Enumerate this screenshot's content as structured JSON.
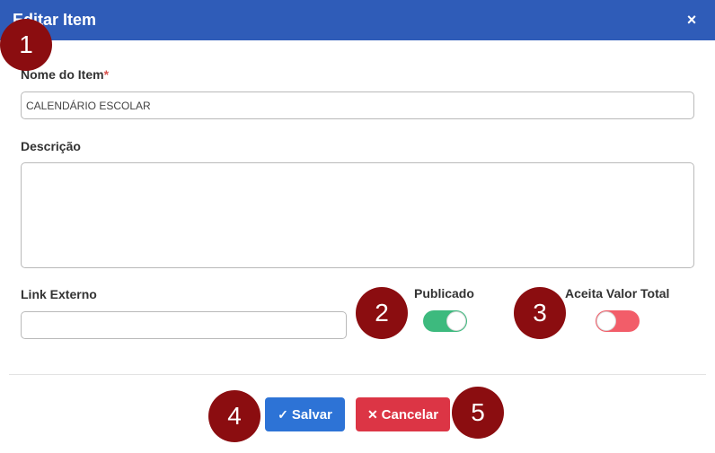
{
  "header": {
    "title": "Editar Item",
    "close_icon": "×"
  },
  "form": {
    "item_name": {
      "label": "Nome do Item",
      "required_mark": "*",
      "value": "CALENDÁRIO ESCOLAR"
    },
    "description": {
      "label": "Descrição",
      "value": ""
    },
    "external_link": {
      "label": "Link Externo",
      "value": ""
    },
    "published": {
      "label": "Publicado",
      "on": true
    },
    "accepts_total_value": {
      "label": "Aceita Valor Total",
      "on": false
    }
  },
  "buttons": {
    "save": {
      "icon": "✓",
      "label": "Salvar"
    },
    "cancel": {
      "icon": "✕",
      "label": "Cancelar"
    }
  },
  "annotations": [
    "1",
    "2",
    "3",
    "4",
    "5"
  ],
  "colors": {
    "header": "#2f5cb8",
    "toggle_on": "#3dba7e",
    "toggle_off": "#f25d69",
    "save": "#2d73d6",
    "cancel": "#dc3545",
    "badge": "#8b0d10"
  }
}
